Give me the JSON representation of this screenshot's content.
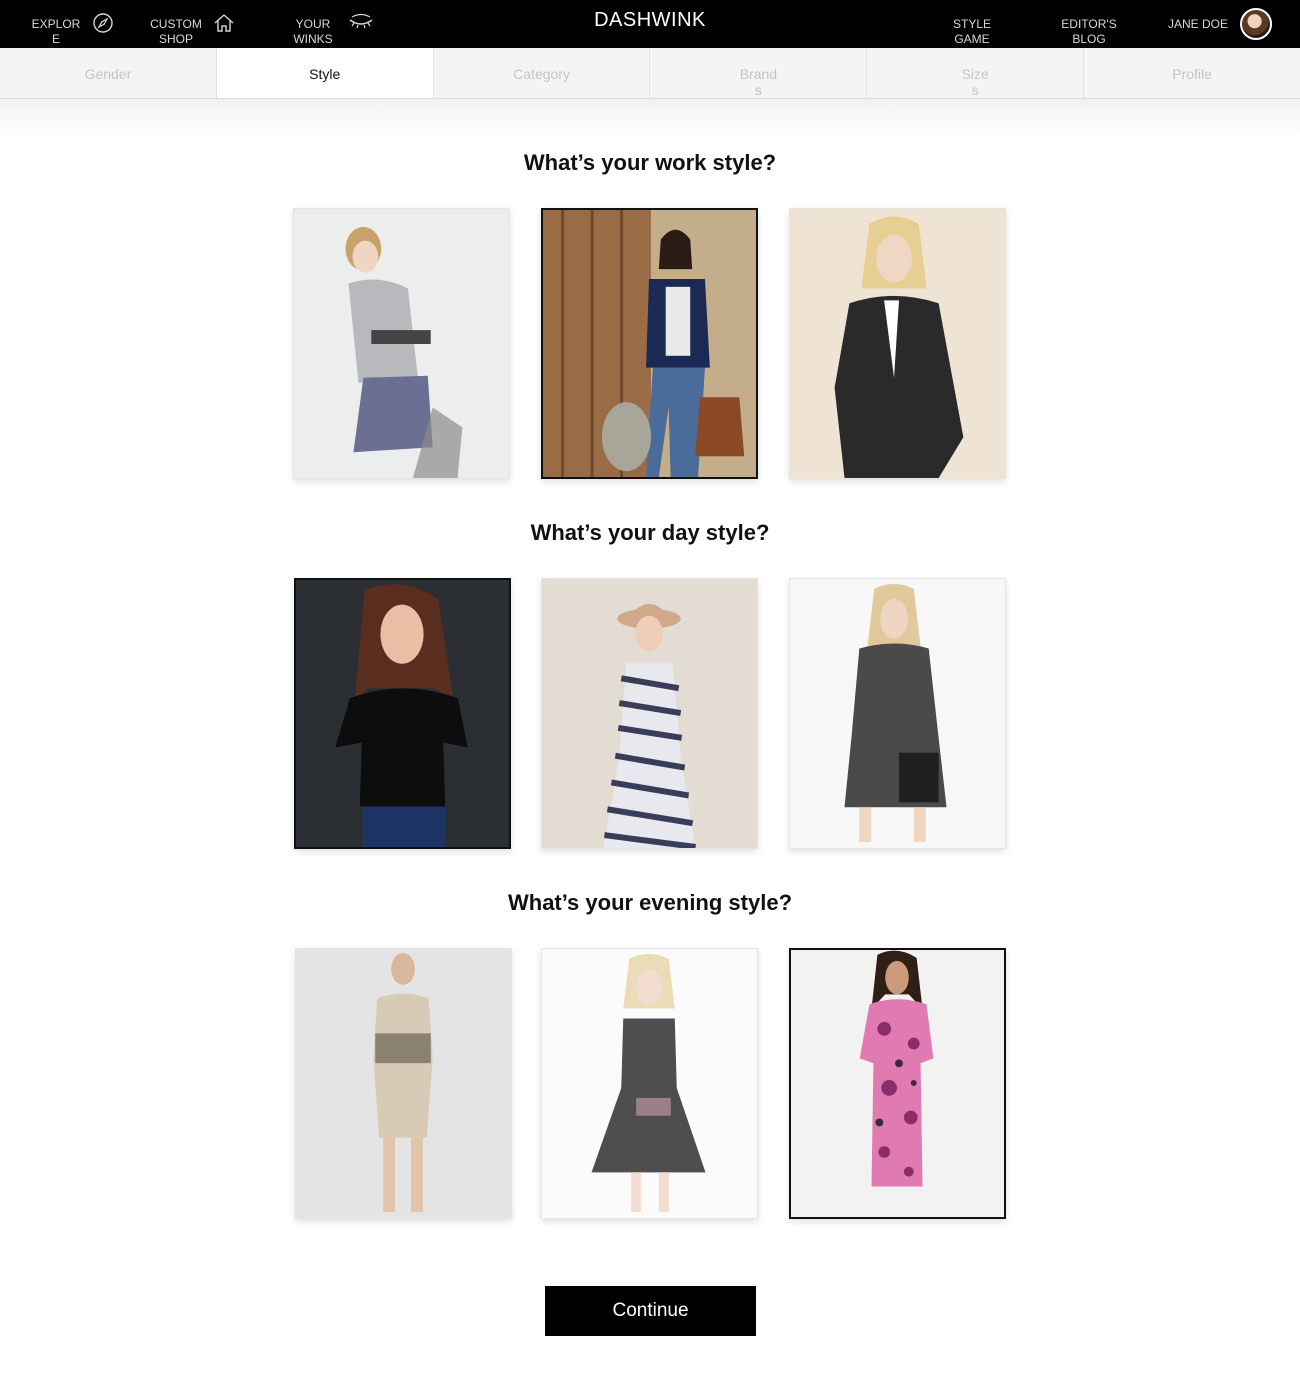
{
  "nav": {
    "brand": "DASHWINK",
    "explore": "EXPLORE",
    "custom_shop": "CUSTOM SHOP",
    "your_winks": "YOUR WINKS",
    "style_game": "STYLE GAME",
    "editors_blog": "EDITOR'S BLOG",
    "user_name": "JANE DOE"
  },
  "steps": [
    "Gender",
    "Style",
    "Category",
    "Brands",
    "Sizes",
    "Profile"
  ],
  "active_step": "Style",
  "sections": [
    {
      "title": "What’s your work style?",
      "selected": 2
    },
    {
      "title": "What’s your day style?",
      "selected": 1
    },
    {
      "title": "What’s your evening style?",
      "selected": 3
    }
  ],
  "continue_label": "Continue",
  "colors": {
    "topbar": "#000000",
    "selected_border": "#111111",
    "inactive_step": "#c4c4c4"
  }
}
